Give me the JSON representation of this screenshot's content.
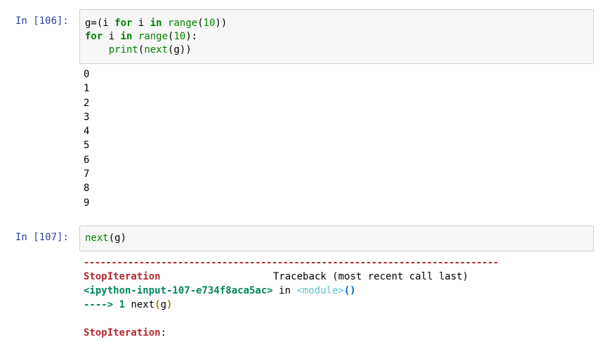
{
  "cells": [
    {
      "prompt": "In [106]:",
      "code": {
        "line1": {
          "a": "g=(i ",
          "b": "for",
          "c": " i ",
          "d": "in",
          "e": " ",
          "f": "range",
          "g": "(",
          "h": "10",
          "i": "))"
        },
        "line2": {
          "a": "for",
          "b": " i ",
          "c": "in",
          "d": " ",
          "e": "range",
          "f": "(",
          "g": "10",
          "h": "):"
        },
        "line3": {
          "indent": "    ",
          "a": "print",
          "b": "(",
          "c": "next",
          "d": "(g))"
        }
      },
      "output": [
        "0",
        "1",
        "2",
        "3",
        "4",
        "5",
        "6",
        "7",
        "8",
        "9"
      ]
    },
    {
      "prompt": "In [107]:",
      "code": {
        "line1": {
          "a": "next",
          "b": "(",
          "c": "g",
          "d": ")"
        }
      },
      "traceback": {
        "divider": "---------------------------------------------------------------------------",
        "error_name": "StopIteration",
        "spacer": "                             ",
        "header_right": "Traceback (most recent call last)",
        "location": "<ipython-input-107-e734f8aca5ac>",
        "in_word": " in ",
        "module": "<module>",
        "parens": "()",
        "arrow": "----> 1",
        "arrow_code_a": " next",
        "arrow_code_b": "(",
        "arrow_code_c": "g",
        "arrow_code_d": ")",
        "final_error": "StopIteration",
        "final_colon": ":"
      }
    }
  ]
}
